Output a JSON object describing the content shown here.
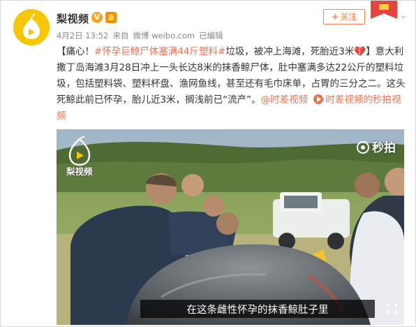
{
  "user": {
    "name": "梨视频",
    "verified_badge": "V",
    "avatar_icon": "pear-logo-icon",
    "brand_color": "#f7c600"
  },
  "meta": {
    "date": "4月2日 13:52",
    "source_prefix": "来自",
    "source": "微博 weibo.com",
    "edited": "已编辑"
  },
  "follow_button": {
    "label": "关注",
    "plus": "+"
  },
  "post": {
    "open": "【痛心！",
    "tag1": "#怀孕巨鲸尸体塞满44斤塑料#",
    "part1": "垃圾，被冲上海滩，死胎近3米",
    "heart": "💔",
    "part2": "】意大利撒丁岛海滩3月28日冲上一头长达8米的抹香鲸尸体，肚中塞满多达22公斤的塑料垃圾，包括塑料袋、塑料杯盘、渔网鱼线，甚至还有毛巾床单，占胃的三分之二。这头死鲸此前已怀孕，胎儿近3米，搁浅前已“流产”。",
    "mention": "@时差视频",
    "link_text": "时差视频的秒拍视频",
    "link_icon": "play-link-icon"
  },
  "video": {
    "watermark_label": "梨视频",
    "miaopai_label": "秒拍",
    "subtitle": "在这条雌性怀孕的抹香鲸肚子里"
  },
  "colors": {
    "accent": "#eb7350",
    "follow": "#ff8140",
    "meta_gray": "#888888"
  }
}
